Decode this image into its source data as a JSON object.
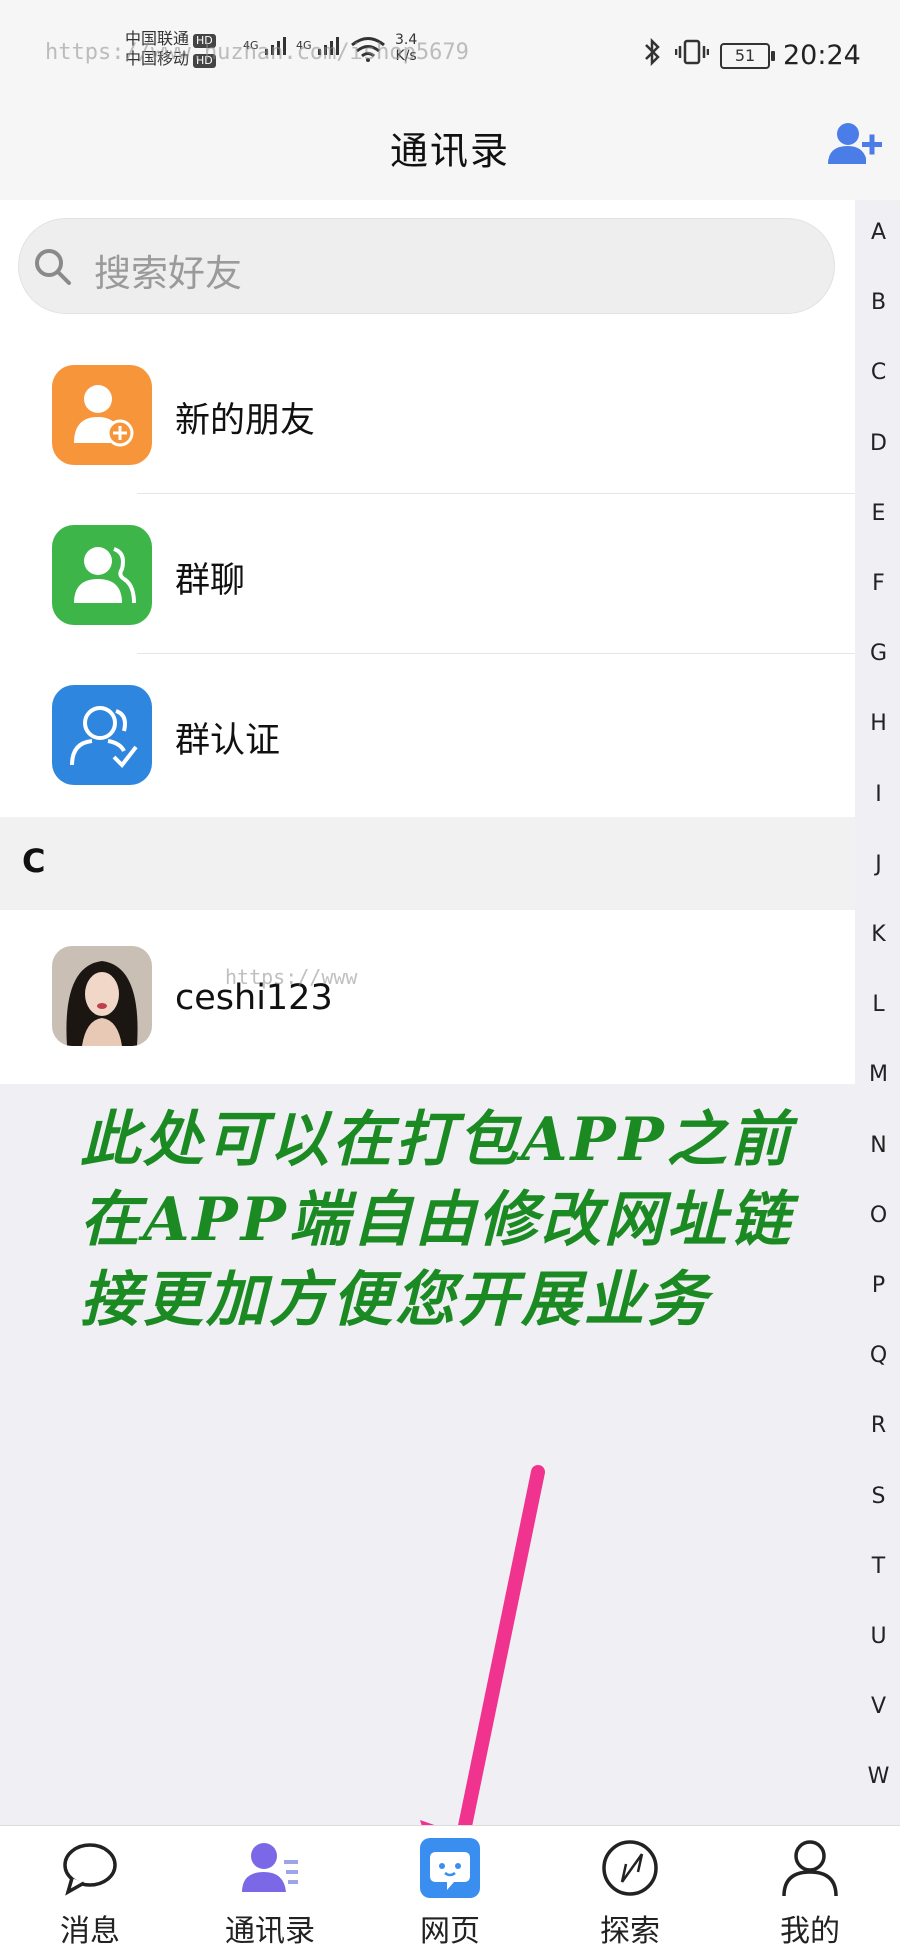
{
  "status_bar": {
    "carrier1": "中国联通",
    "carrier2": "中国移动",
    "hd": "HD",
    "network1": "4G",
    "network2": "4G",
    "speed_value": "3.4",
    "speed_unit": "K/s",
    "battery": "51",
    "time": "20:24",
    "watermark": "https://www.huzhan.com/ishop5679"
  },
  "header": {
    "title": "通讯录",
    "add_icon": "add-contact-icon"
  },
  "search": {
    "placeholder": "搜索好友"
  },
  "functions": [
    {
      "label": "新的朋友",
      "icon": "new-friend-icon",
      "color": "#f7953a"
    },
    {
      "label": "群聊",
      "icon": "group-chat-icon",
      "color": "#3db548"
    },
    {
      "label": "群认证",
      "icon": "group-verify-icon",
      "color": "#2f86de"
    }
  ],
  "section": {
    "letter": "C"
  },
  "contacts": [
    {
      "name": "ceshi123",
      "watermark": "https://www"
    }
  ],
  "index_letters": [
    "A",
    "B",
    "C",
    "D",
    "E",
    "F",
    "G",
    "H",
    "I",
    "J",
    "K",
    "L",
    "M",
    "N",
    "O",
    "P",
    "Q",
    "R",
    "S",
    "T",
    "U",
    "V",
    "W"
  ],
  "annotation": {
    "line1": "此处可以在打包APP之前",
    "line2": "在APP端自由修改网址链",
    "line3": "接更加方便您开展业务",
    "color": "#1b8a22",
    "arrow_color": "#f0338f"
  },
  "bottom_nav": [
    {
      "label": "消息",
      "icon": "chat-bubble-icon"
    },
    {
      "label": "通讯录",
      "icon": "contacts-icon",
      "active": true
    },
    {
      "label": "网页",
      "icon": "webpage-icon"
    },
    {
      "label": "探索",
      "icon": "compass-icon"
    },
    {
      "label": "我的",
      "icon": "profile-icon"
    }
  ],
  "colors": {
    "accent": "#4a7de8",
    "contacts_purple": "#7a68e6"
  }
}
